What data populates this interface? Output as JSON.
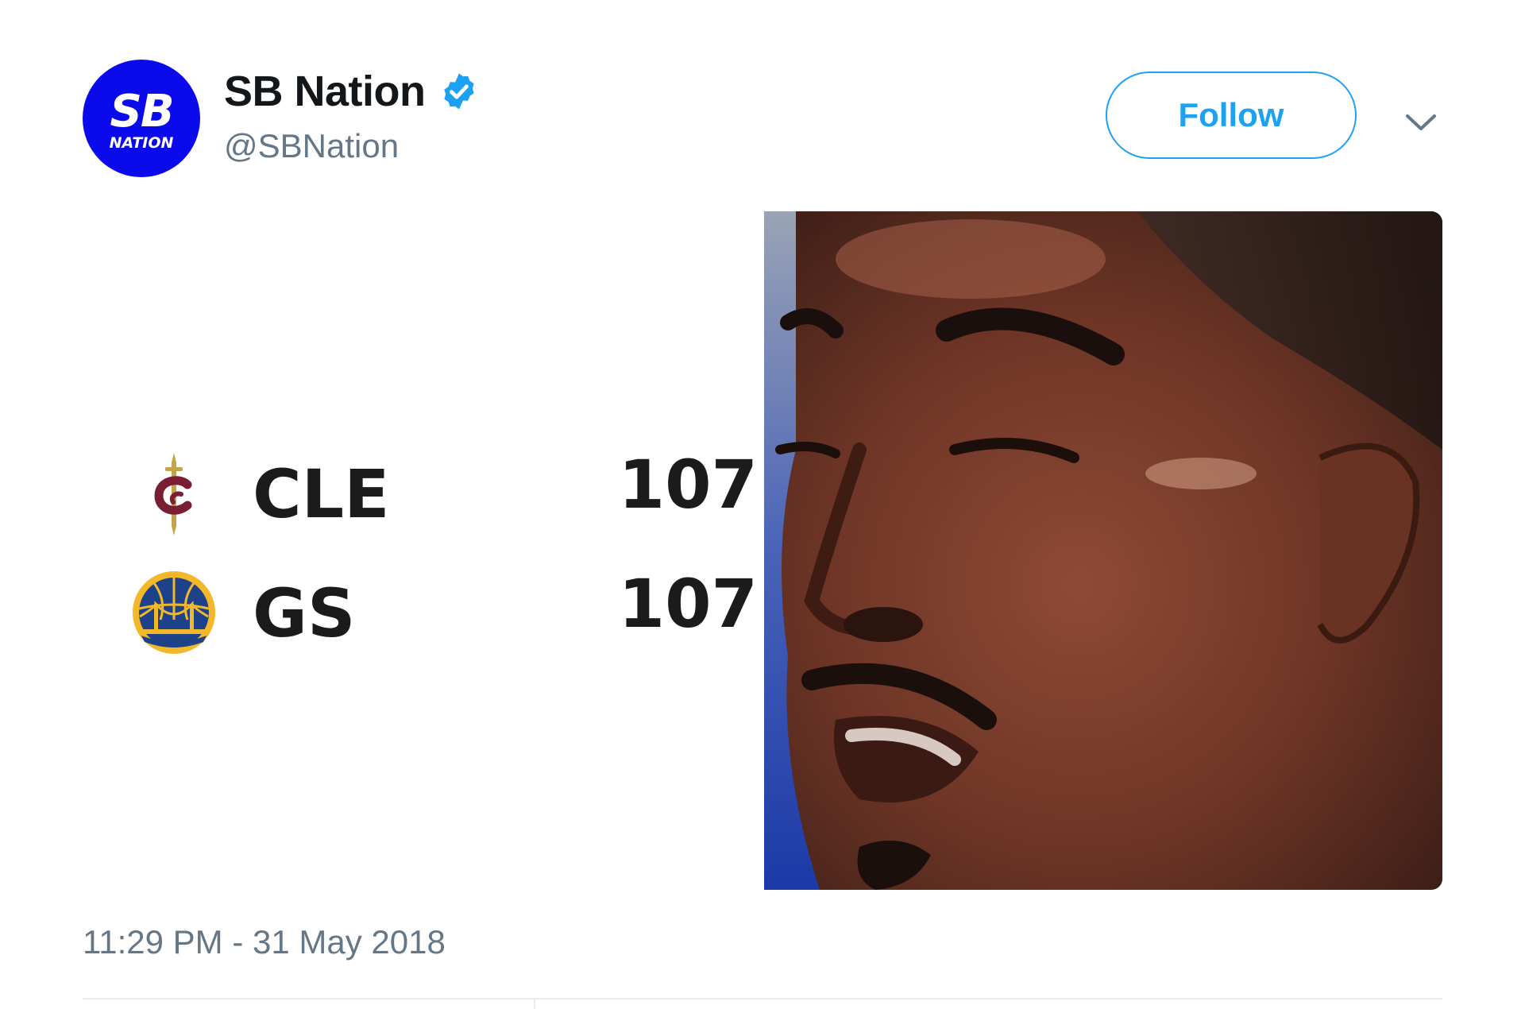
{
  "tweet": {
    "author": {
      "display_name": "SB Nation",
      "handle": "@SBNation",
      "verified": true,
      "avatar": {
        "line1": "SB",
        "line2": "NATION",
        "color": "#0a0aeb"
      }
    },
    "follow_label": "Follow",
    "more_icon": "chevron-down-icon",
    "timestamp": "11:29 PM - 31 May 2018",
    "media": {
      "scoreboard": {
        "teams": [
          {
            "abbr": "CLE",
            "score": "107",
            "logo": "cavaliers-logo-icon"
          },
          {
            "abbr": "GS",
            "score": "107",
            "logo": "warriors-logo-icon"
          }
        ]
      },
      "photo": "player-face-photo"
    }
  },
  "colors": {
    "accent": "#1da1f2",
    "text_primary": "#14171a",
    "text_secondary": "#657786",
    "divider": "#e6ecf0"
  }
}
